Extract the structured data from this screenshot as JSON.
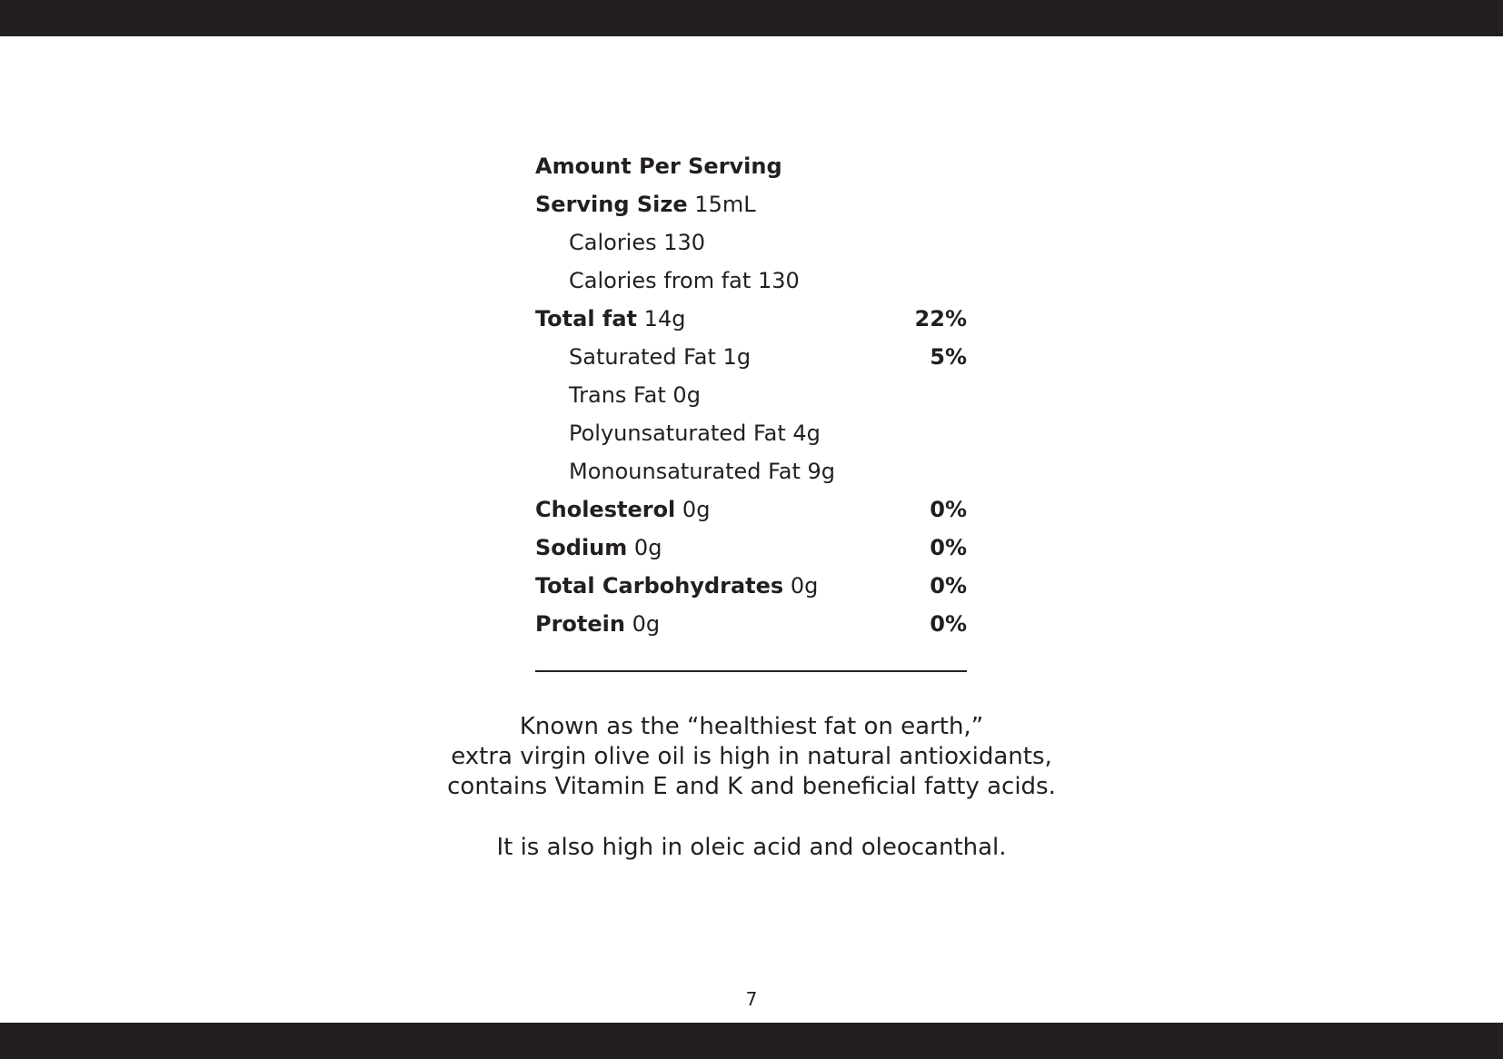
{
  "nutrition": {
    "header": "Amount Per Serving",
    "serving_size": {
      "label": "Serving Size",
      "value": "15mL"
    },
    "rows": [
      {
        "name": "Calories",
        "amount": "130",
        "dv": ""
      },
      {
        "name": "Calories from fat",
        "amount": "130",
        "dv": ""
      },
      {
        "name": "Total fat",
        "amount": "14g",
        "dv": "22%"
      },
      {
        "name": "Saturated Fat",
        "amount": "1g",
        "dv": "5%"
      },
      {
        "name": "Trans Fat",
        "amount": "0g",
        "dv": ""
      },
      {
        "name": "Polyunsaturated Fat",
        "amount": "4g",
        "dv": ""
      },
      {
        "name": "Monounsaturated Fat",
        "amount": "9g",
        "dv": ""
      },
      {
        "name": "Cholesterol",
        "amount": "0g",
        "dv": "0%"
      },
      {
        "name": "Sodium",
        "amount": "0g",
        "dv": "0%"
      },
      {
        "name": "Total Carbohydrates",
        "amount": "0g",
        "dv": "0%"
      },
      {
        "name": "Protein",
        "amount": "0g",
        "dv": "0%"
      }
    ]
  },
  "description": {
    "lines": [
      "Known as the “healthiest fat on earth,”",
      "extra virgin olive oil is high in natural antioxidants,",
      "contains Vitamin E and K and beneficial fatty acids."
    ],
    "closing": "It is also high in oleic acid and oleocanthal."
  },
  "page_number": "7",
  "colors": {
    "ink": "#231f20",
    "background": "#ffffff",
    "frame_bars": "#231f20"
  }
}
